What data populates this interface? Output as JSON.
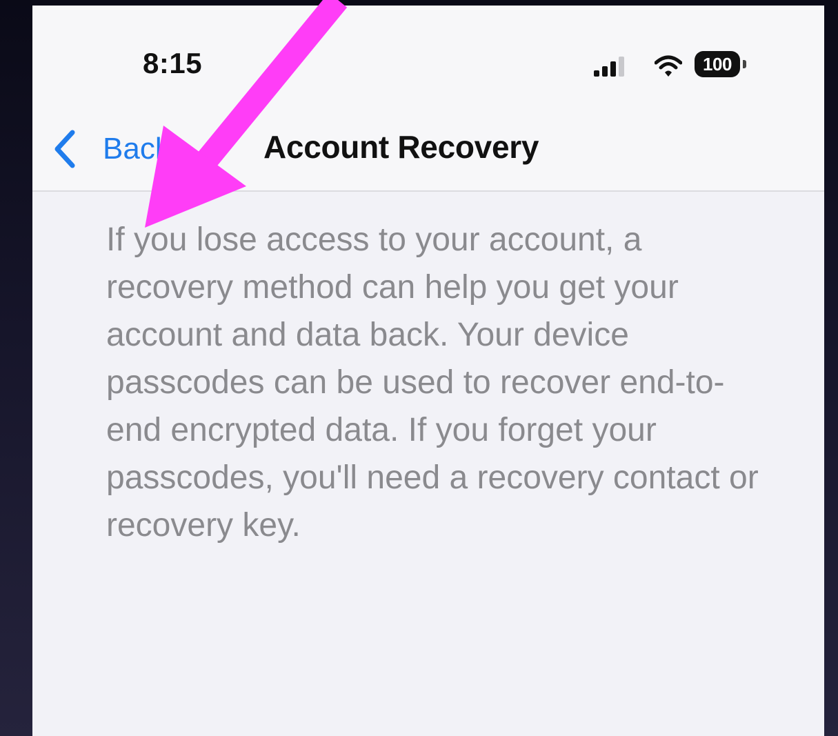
{
  "status_bar": {
    "time": "8:15",
    "battery": "100",
    "icons": [
      "signal-icon",
      "wifi-icon",
      "battery-icon"
    ]
  },
  "nav_bar": {
    "back_label": "Back",
    "title": "Account Recovery"
  },
  "content": {
    "description": "If you lose access to your account, a recovery method can help you get your account and data back. Your device passcodes can be used to recover end-to-end encrypted data. If you forget your passcodes, you'll need a recovery contact or recovery key."
  },
  "annotation": {
    "icon": "arrow-annotation-icon",
    "color": "#ff3df7"
  },
  "colors": {
    "accent": "#1f7cec",
    "secondary_text": "#8a8a8e",
    "background": "#f2f2f7"
  }
}
